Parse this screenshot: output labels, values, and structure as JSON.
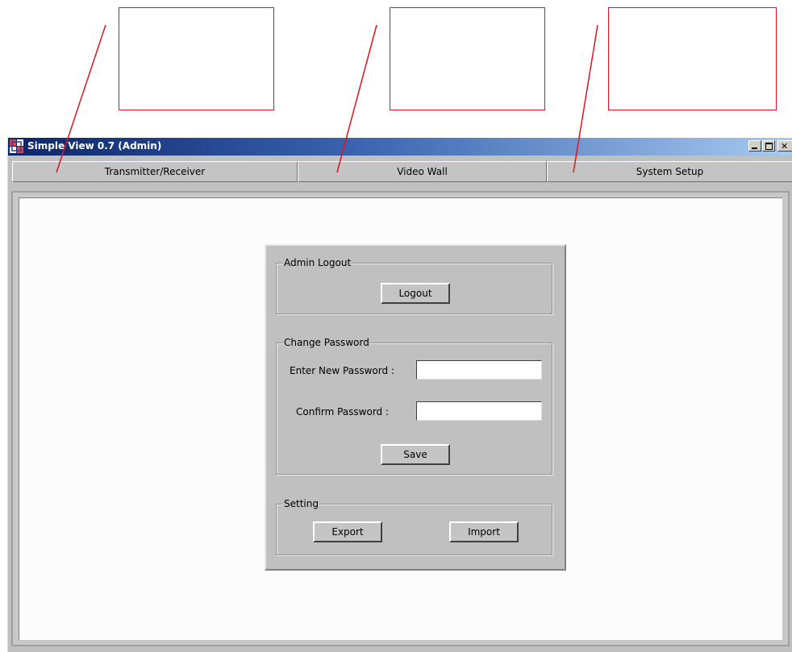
{
  "window": {
    "title": "Simple View 0.7 (Admin)",
    "controls": {
      "minimize_icon": "minimize-icon",
      "maximize_icon": "maximize-icon",
      "close_label": "✕"
    }
  },
  "tabs": [
    {
      "label": "Transmitter/Receiver"
    },
    {
      "label": "Video Wall"
    },
    {
      "label": "System Setup"
    }
  ],
  "admin_logout": {
    "title": "Admin Logout",
    "logout_label": "Logout"
  },
  "change_password": {
    "title": "Change Password",
    "new_password_label": "Enter New Password :",
    "new_password_value": "",
    "confirm_password_label": "Confirm Password :",
    "confirm_password_value": "",
    "save_label": "Save"
  },
  "setting": {
    "title": "Setting",
    "export_label": "Export",
    "import_label": "Import"
  },
  "colors": {
    "callout": "#e0141e",
    "titlebar_start": "#0a246a",
    "titlebar_end": "#a6caf0",
    "panel_bg": "#c0c0c0"
  }
}
